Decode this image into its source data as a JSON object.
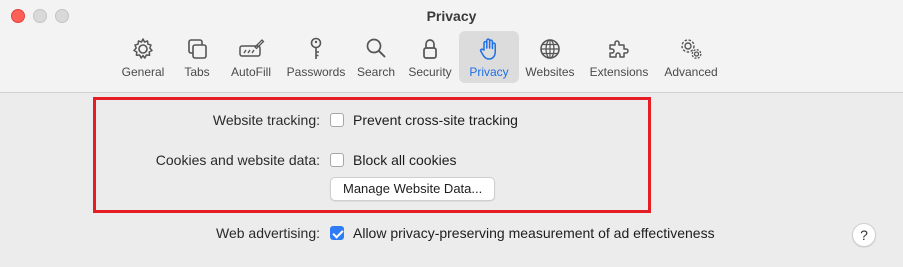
{
  "window": {
    "title": "Privacy"
  },
  "toolbar": {
    "items": [
      {
        "label": "General",
        "icon": "gear-icon"
      },
      {
        "label": "Tabs",
        "icon": "tabs-icon"
      },
      {
        "label": "AutoFill",
        "icon": "autofill-icon"
      },
      {
        "label": "Passwords",
        "icon": "key-icon"
      },
      {
        "label": "Search",
        "icon": "magnifier-icon"
      },
      {
        "label": "Security",
        "icon": "lock-icon"
      },
      {
        "label": "Privacy",
        "icon": "hand-icon"
      },
      {
        "label": "Websites",
        "icon": "globe-icon"
      },
      {
        "label": "Extensions",
        "icon": "puzzle-icon"
      },
      {
        "label": "Advanced",
        "icon": "gears-icon"
      }
    ],
    "selected": "Privacy",
    "accent_color": "#1f6fe5"
  },
  "privacy": {
    "website_tracking_label": "Website tracking:",
    "prevent_tracking_text": "Prevent cross-site tracking",
    "prevent_tracking_checked": false,
    "cookies_label": "Cookies and website data:",
    "block_cookies_text": "Block all cookies",
    "block_cookies_checked": false,
    "manage_button": "Manage Website Data...",
    "web_advertising_label": "Web advertising:",
    "ad_measurement_text": "Allow privacy-preserving measurement of ad effectiveness",
    "ad_measurement_checked": true
  },
  "help": {
    "symbol": "?"
  },
  "highlight_color": "#e51e25"
}
